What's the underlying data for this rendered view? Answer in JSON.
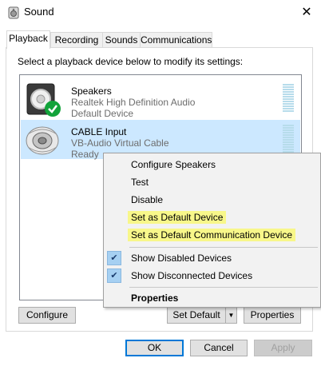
{
  "window": {
    "title": "Sound",
    "close_glyph": "✕"
  },
  "tabs": [
    {
      "label": "Playback",
      "active": true
    },
    {
      "label": "Recording"
    },
    {
      "label": "Sounds"
    },
    {
      "label": "Communications"
    }
  ],
  "instruction": "Select a playback device below to modify its settings:",
  "devices": [
    {
      "name": "Speakers",
      "desc": "Realtek High Definition Audio",
      "status": "Default Device",
      "icon": "speaker-icon",
      "badge": "green-check-badge"
    },
    {
      "name": "CABLE Input",
      "desc": "VB-Audio Virtual Cable",
      "status": "Ready",
      "icon": "cable-icon",
      "selected": true
    }
  ],
  "context_menu": {
    "items": [
      {
        "label": "Configure Speakers"
      },
      {
        "label": "Test"
      },
      {
        "label": "Disable"
      },
      {
        "label": "Set as Default Device",
        "highlighted": true
      },
      {
        "label": "Set as Default Communication Device",
        "highlighted": true
      },
      {
        "label": "Show Disabled Devices",
        "checked": true
      },
      {
        "label": "Show Disconnected Devices",
        "checked": true
      },
      {
        "label": "Properties",
        "bold": true
      }
    ],
    "check_glyph": "✔"
  },
  "buttons": {
    "configure": "Configure",
    "set_default": "Set Default",
    "split_glyph": "▼",
    "properties": "Properties",
    "ok": "OK",
    "cancel": "Cancel",
    "apply": "Apply"
  },
  "colors": {
    "selection": "#cce8ff",
    "highlight": "#f8f78a",
    "accent": "#0078d7",
    "badge": "#11a33a"
  }
}
